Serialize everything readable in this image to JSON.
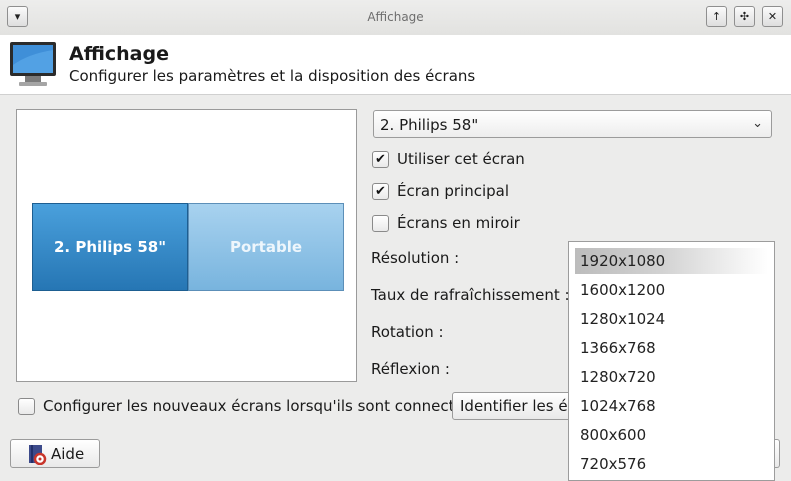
{
  "window": {
    "title": "Affichage",
    "controls": [
      {
        "name": "window-menu-button",
        "glyph": "▾"
      },
      {
        "name": "keep-above-button",
        "glyph": "↑"
      },
      {
        "name": "maximize-button",
        "glyph": "✣"
      },
      {
        "name": "close-button",
        "glyph": "✕"
      }
    ]
  },
  "header": {
    "title": "Affichage",
    "subtitle": "Configurer les paramètres et la disposition des écrans",
    "icon": "monitor-icon"
  },
  "preview": {
    "screens": [
      {
        "label": "2. Philips 58\"",
        "active": true
      },
      {
        "label": "Portable",
        "active": false
      }
    ]
  },
  "display_select": {
    "value": "2. Philips 58\""
  },
  "options": {
    "use_display": {
      "label": "Utiliser cet écran",
      "checked": true
    },
    "primary_display": {
      "label": "Écran principal",
      "checked": true
    },
    "mirror_displays": {
      "label": "Écrans en miroir",
      "checked": false
    }
  },
  "fields": {
    "resolution": "Résolution :",
    "refresh_rate": "Taux de rafraîchissement :",
    "rotation": "Rotation :",
    "reflection": "Réflexion :"
  },
  "bottom": {
    "auto_configure": {
      "label": "Configurer les nouveaux écrans lorsqu'ils sont connectés",
      "checked": false
    },
    "identify_button": "Identifier les écrans",
    "help_button": "Aide"
  },
  "resolution_dropdown": {
    "selected": "1920x1080",
    "options": [
      "1920x1080",
      "1600x1200",
      "1280x1024",
      "1366x768",
      "1280x720",
      "1024x768",
      "800x600",
      "720x576"
    ]
  },
  "colors": {
    "active_screen": "#2f86c9",
    "inactive_screen": "#8cc2e6",
    "window_bg": "#ececeb"
  }
}
